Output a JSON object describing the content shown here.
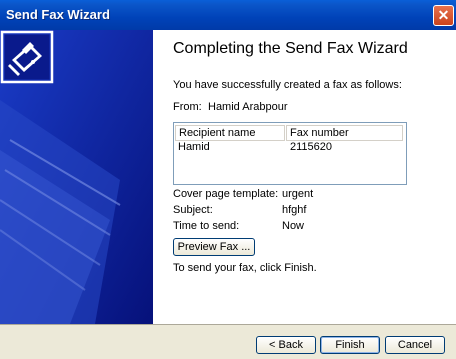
{
  "window": {
    "title": "Send Fax Wizard"
  },
  "main": {
    "heading": "Completing the Send Fax Wizard",
    "subtitle": "You have successfully created a fax as follows:",
    "from_label": "From:",
    "from_value": "Hamid Arabpour",
    "recipients": {
      "headers": [
        "Recipient name",
        "Fax number"
      ],
      "rows": [
        [
          "Hamid",
          "2115620"
        ]
      ]
    },
    "cover_label": "Cover page template:",
    "cover_value": "urgent",
    "subject_label": "Subject:",
    "subject_value": "hfghf",
    "time_label": "Time to send:",
    "time_value": "Now",
    "preview_button": "Preview Fax ...",
    "instruction": "To send your fax, click Finish."
  },
  "footer": {
    "back": "< Back",
    "finish": "Finish",
    "cancel": "Cancel"
  },
  "colors": {
    "titlebar": "#0042b8",
    "sidebar": "#0a1a8c",
    "close": "#c9431d"
  },
  "icons": {
    "close": "close-icon",
    "wizard": "fax-machine-icon"
  }
}
